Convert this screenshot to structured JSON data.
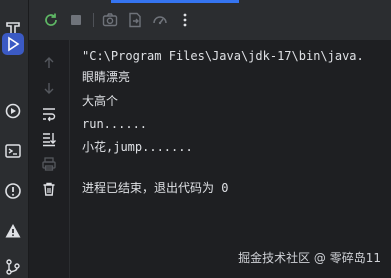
{
  "console": {
    "lines": [
      "\"C:\\Program Files\\Java\\jdk-17\\bin\\java.",
      "眼睛漂亮",
      "大高个",
      "run......",
      "小花,jump.......",
      "",
      "进程已结束，退出代码为 0"
    ]
  },
  "watermark": "掘金技术社区 @ 零碎岛11",
  "colors": {
    "background": "#1e1f22",
    "panel": "#2b2d30",
    "accent": "#3574f0",
    "run_green": "#5fb865",
    "stop_gray": "#6f737a",
    "warning_red": "#db5c5c"
  },
  "icons": {
    "left_strip": [
      "hammer-icon",
      "run-icon",
      "services-icon",
      "terminal-icon",
      "problems-icon",
      "warning-icon",
      "git-icon"
    ],
    "toolbar": [
      "rerun-icon",
      "stop-icon",
      "camera-icon",
      "export-icon",
      "settings-icon",
      "more-icon"
    ],
    "gutter": [
      "up-arrow-icon",
      "down-arrow-icon",
      "soft-wrap-icon",
      "scroll-to-end-icon",
      "print-icon",
      "trash-icon"
    ]
  }
}
